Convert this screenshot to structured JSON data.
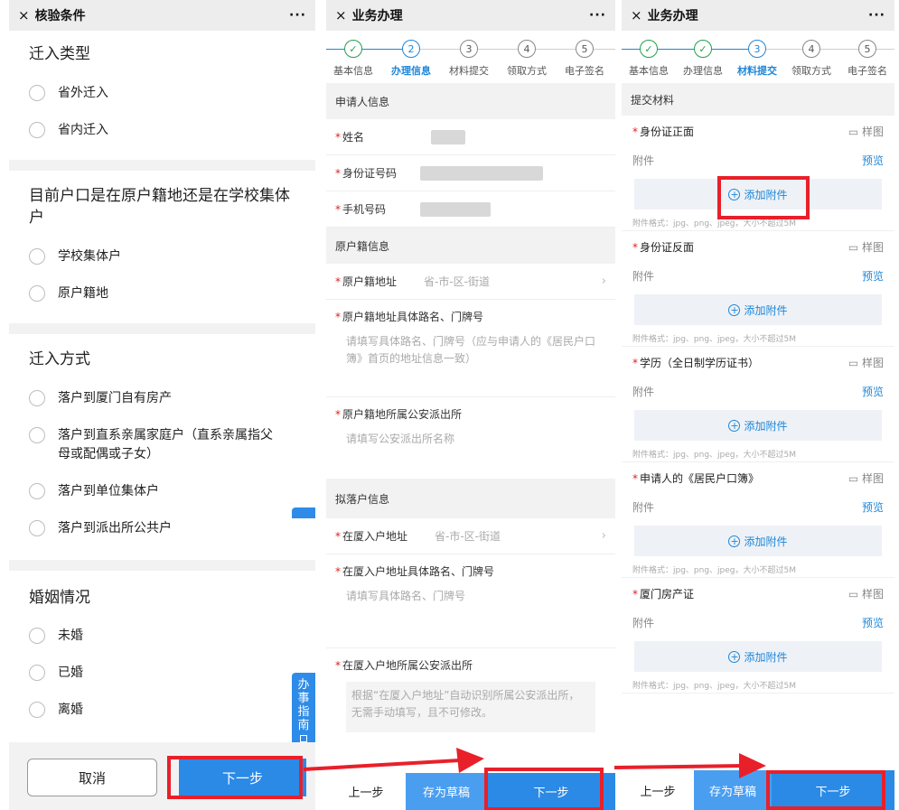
{
  "colors": {
    "accent": "#2b8ae6",
    "done_green": "#22a04b",
    "required_red": "#e02020",
    "highlight_red": "#e8202a"
  },
  "panel1": {
    "close_icon": "×",
    "title": "核验条件",
    "more": "···",
    "sections": [
      {
        "heading": "迁入类型",
        "options": [
          "省外迁入",
          "省内迁入"
        ]
      },
      {
        "heading": "目前户口是在原户籍地还是在学校集体户",
        "options": [
          "学校集体户",
          "原户籍地"
        ]
      },
      {
        "heading": "迁入方式",
        "options": [
          "落户到厦门自有房产",
          "落户到直系亲属家庭户（直系亲属指父母或配偶或子女）",
          "落户到单位集体户",
          "落户到派出所公共户"
        ]
      },
      {
        "heading": "婚姻情况",
        "options": [
          "未婚",
          "已婚",
          "离婚"
        ]
      }
    ],
    "guide_tab": [
      "办",
      "事",
      "指",
      "南"
    ],
    "cancel_label": "取消",
    "next_label": "下一步"
  },
  "steps": [
    {
      "num": "✓",
      "label": "基本信息"
    },
    {
      "num": "2",
      "label": "办理信息"
    },
    {
      "num": "3",
      "label": "材料提交"
    },
    {
      "num": "4",
      "label": "领取方式"
    },
    {
      "num": "5",
      "label": "电子签名"
    }
  ],
  "panel2": {
    "close_icon": "×",
    "title": "业务办理",
    "more": "···",
    "applicant_header": "申请人信息",
    "name_label": "姓名",
    "id_label": "身份证号码",
    "phone_label": "手机号码",
    "origin_header": "原户籍信息",
    "origin_addr_label": "原户籍地址",
    "origin_addr_placeholder": "省-市-区-街道",
    "origin_street_label": "原户籍地址具体路名、门牌号",
    "origin_street_placeholder": "请填写具体路名、门牌号（应与申请人的《居民户口簿》首页的地址信息一致）",
    "origin_police_label": "原户籍地所属公安派出所",
    "origin_police_placeholder": "请填写公安派出所名称",
    "target_header": "拟落户信息",
    "xm_addr_label": "在厦入户地址",
    "xm_addr_placeholder": "省-市-区-街道",
    "xm_street_label": "在厦入户地址具体路名、门牌号",
    "xm_street_placeholder": "请填写具体路名、门牌号",
    "xm_police_label": "在厦入户地所属公安派出所",
    "xm_police_note": "根据“在厦入户地址”自动识别所属公安派出所，无需手动填写，且不可修改。",
    "prev_label": "上一步",
    "draft_label": "存为草稿",
    "next_label": "下一步"
  },
  "panel3": {
    "close_icon": "×",
    "title": "业务办理",
    "more": "···",
    "section_header": "提交材料",
    "sample_label": "样图",
    "attach_label": "附件",
    "preview_label": "预览",
    "add_label": "添加附件",
    "format_note": "附件格式：jpg、png、jpeg，大小不超过5M",
    "docs": [
      "身份证正面",
      "身份证反面",
      "学历（全日制学历证书）",
      "申请人的《居民户口簿》",
      "厦门房产证"
    ],
    "prev_label": "上一步",
    "draft_label": "存为草稿",
    "next_label": "下一步"
  }
}
